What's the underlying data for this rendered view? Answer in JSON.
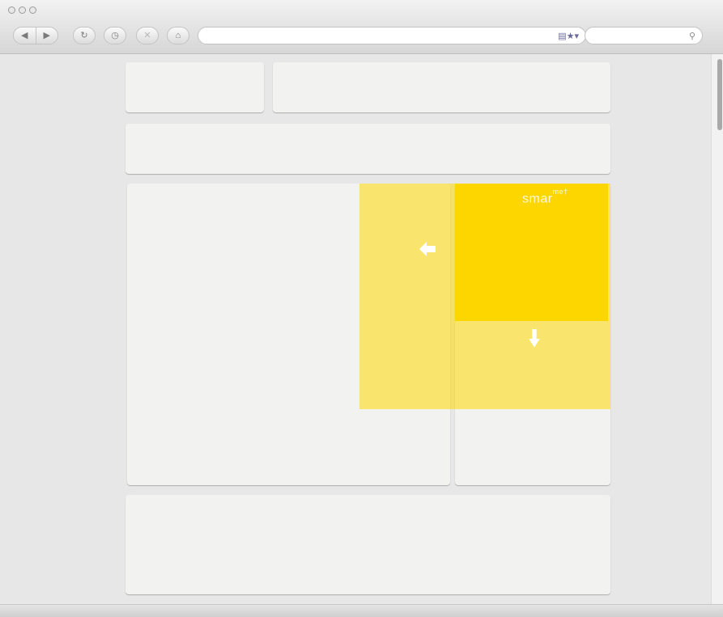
{
  "browser": {
    "toolbar": {
      "back_glyph": "◀",
      "forward_glyph": "▶",
      "reload_glyph": "↻",
      "history_glyph": "◷",
      "stop_glyph": "✕",
      "home_glyph": "⌂",
      "url_value": "",
      "url_icons_glyph": "▤★▾",
      "search_placeholder": "",
      "search_glyph": "⚲"
    }
  },
  "page": {
    "brand_text": "smar",
    "brand_superscript": "me†"
  },
  "colors": {
    "overlay_light": "#ffdd33",
    "overlay_strong": "#fdd600",
    "arrow": "#ffffff"
  },
  "icons": {
    "left_arrow": "arrow-left-icon",
    "down_arrow": "arrow-down-icon"
  }
}
